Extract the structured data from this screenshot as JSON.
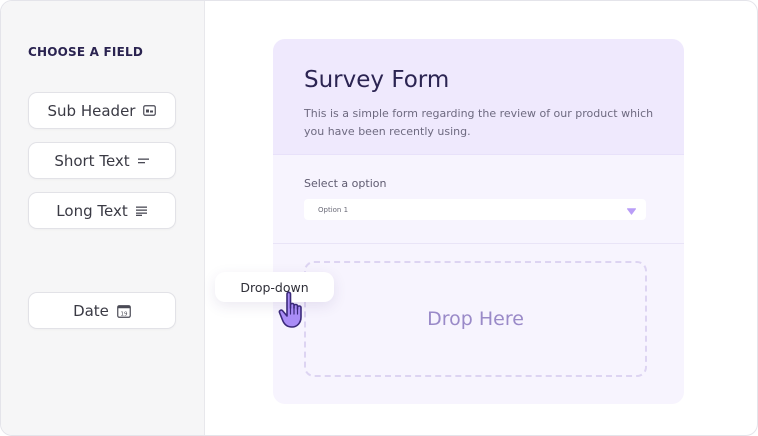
{
  "sidebar": {
    "title": "CHOOSE A FIELD",
    "items": [
      {
        "label": "Sub Header",
        "icon": "sub-header-icon"
      },
      {
        "label": "Short Text",
        "icon": "short-text-icon"
      },
      {
        "label": "Long Text",
        "icon": "long-text-icon"
      },
      {
        "label": "Date",
        "icon": "calendar-icon",
        "icon_text": "19"
      }
    ]
  },
  "form": {
    "title": "Survey Form",
    "description": "This is a simple form regarding the review of our product which you have been recently using.",
    "select_label": "Select a option",
    "select_value": "Option 1",
    "drop_zone_text": "Drop Here"
  },
  "dragging": {
    "label": "Drop-down",
    "cursor_icon": "hand-pointer-icon"
  },
  "colors": {
    "accent": "#a78bfa",
    "card_header": "#efe9fd",
    "card_body": "#f7f4fe",
    "title": "#2b2452"
  }
}
